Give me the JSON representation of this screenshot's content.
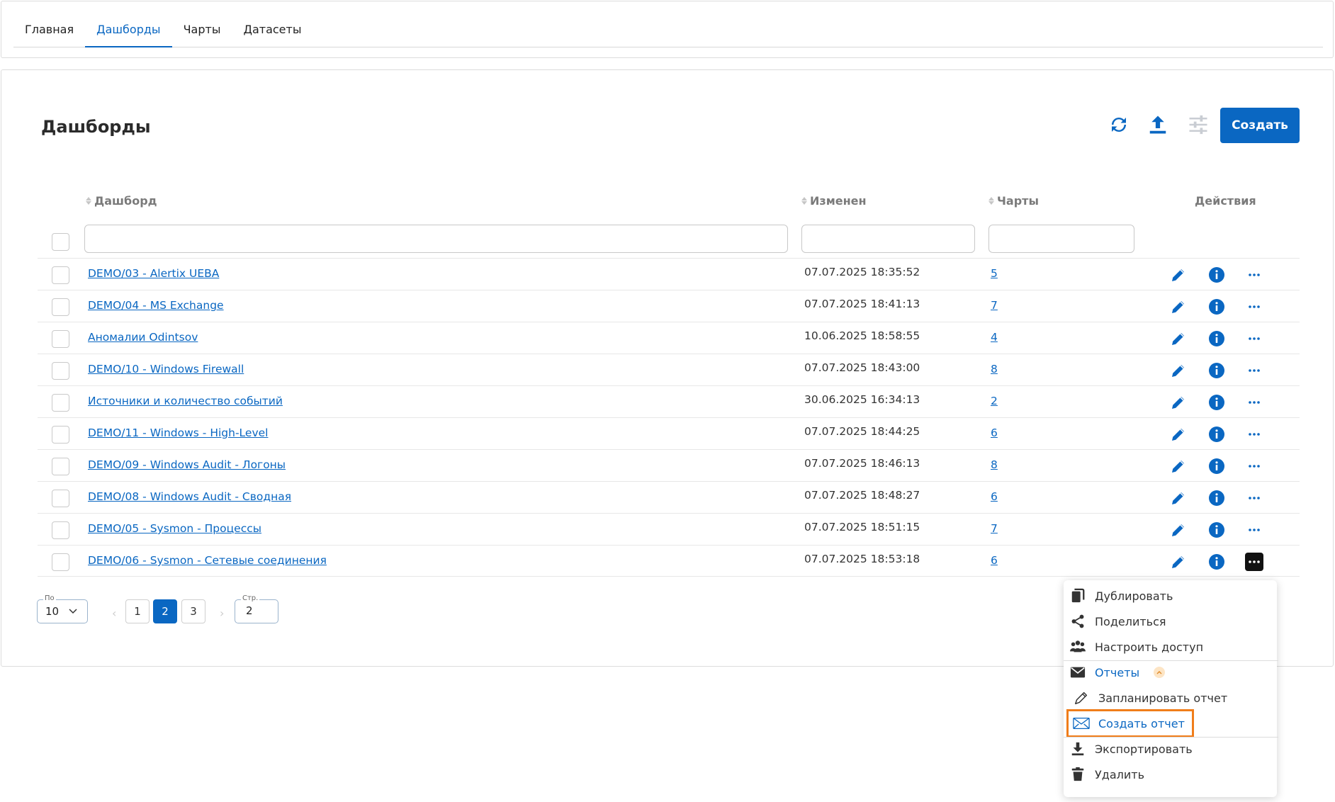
{
  "nav": {
    "tabs": [
      {
        "label": "Главная"
      },
      {
        "label": "Дашборды"
      },
      {
        "label": "Чарты"
      },
      {
        "label": "Датасеты"
      }
    ]
  },
  "page": {
    "title": "Дашборды",
    "create_label": "Создать"
  },
  "table": {
    "columns": {
      "name": "Дашборд",
      "modified": "Изменен",
      "charts": "Чарты",
      "actions": "Действия"
    },
    "rows": [
      {
        "name": "DEMO/03 - Alertix UEBA",
        "modified": "07.07.2025 18:35:52",
        "charts": "5"
      },
      {
        "name": "DEMO/04 - MS Exchange",
        "modified": "07.07.2025 18:41:13",
        "charts": "7"
      },
      {
        "name": "Аномалии Odintsov",
        "modified": "10.06.2025 18:58:55",
        "charts": "4"
      },
      {
        "name": "DEMO/10 - Windows Firewall",
        "modified": "07.07.2025 18:43:00",
        "charts": "8"
      },
      {
        "name": "Источники и количество событий",
        "modified": "30.06.2025 16:34:13",
        "charts": "2"
      },
      {
        "name": "DEMO/11 - Windows - High-Level",
        "modified": "07.07.2025 18:44:25",
        "charts": "6"
      },
      {
        "name": "DEMO/09 - Windows Audit - Логоны",
        "modified": "07.07.2025 18:46:13",
        "charts": "8"
      },
      {
        "name": "DEMO/08 - Windows Audit - Сводная",
        "modified": "07.07.2025 18:48:27",
        "charts": "6"
      },
      {
        "name": "DEMO/05 - Sysmon - Процессы",
        "modified": "07.07.2025 18:51:15",
        "charts": "7"
      },
      {
        "name": "DEMO/06 - Sysmon - Сетевые соединения",
        "modified": "07.07.2025 18:53:18",
        "charts": "6"
      }
    ]
  },
  "pagination": {
    "page_size_label": "По",
    "page_size": "10",
    "pages": [
      "1",
      "2",
      "3"
    ],
    "current_page": "2",
    "page_input_label": "Стр.",
    "page_input_value": "2",
    "prev_glyph": "‹",
    "next_glyph": "›"
  },
  "menu": {
    "duplicate": "Дублировать",
    "share": "Поделиться",
    "access": "Настроить доступ",
    "reports": "Отчеты",
    "schedule_report": "Запланировать отчет",
    "create_report": "Создать отчет",
    "export": "Экспортировать",
    "delete": "Удалить"
  },
  "colors": {
    "accent": "#0a67c2",
    "highlight": "#f07d1a"
  },
  "icons": [
    "refresh-icon",
    "upload-icon",
    "sliders-icon",
    "pencil-icon",
    "info-icon",
    "ellipsis-icon",
    "copy-icon",
    "share-icon",
    "users-icon",
    "envelope-icon",
    "chevron-up-icon",
    "pencil-outline-icon",
    "download-icon",
    "trash-icon",
    "chevron-down-icon"
  ]
}
